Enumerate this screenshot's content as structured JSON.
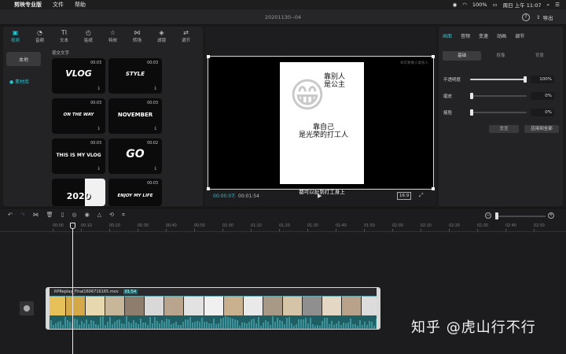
{
  "menubar": {
    "app_name": "剪映专业版",
    "items": [
      "文件",
      "帮助"
    ],
    "status": {
      "battery": "100%",
      "datetime": "周日 上午 11:07"
    }
  },
  "titlebar": {
    "title": "20201130--04",
    "export_label": "导出"
  },
  "media_panel": {
    "tabs": [
      {
        "label": "视频",
        "icon": "video-icon"
      },
      {
        "label": "音频",
        "icon": "audio-icon"
      },
      {
        "label": "文本",
        "icon": "text-icon"
      },
      {
        "label": "贴纸",
        "icon": "sticker-icon"
      },
      {
        "label": "特效",
        "icon": "effects-icon"
      },
      {
        "label": "转场",
        "icon": "transition-icon"
      },
      {
        "label": "滤镜",
        "icon": "filter-icon"
      },
      {
        "label": "调节",
        "icon": "adjust-icon"
      }
    ],
    "side": {
      "local": "本地",
      "library": "● 素材库"
    },
    "grid_title": "现交文字",
    "thumbs": [
      {
        "label": "VLOG",
        "duration": "00:03"
      },
      {
        "label": "STYLE",
        "duration": "00:03"
      },
      {
        "label": "ON THE WAY",
        "duration": "00:03"
      },
      {
        "label": "NOVEMBER",
        "duration": "00:03"
      },
      {
        "label": "THIS IS MY VLOG",
        "duration": "00:03"
      },
      {
        "label": "GO",
        "duration": "00:02"
      },
      {
        "label": "2020",
        "duration": "00:03"
      },
      {
        "label": "ENJOY MY LIFE",
        "duration": "00:03"
      }
    ]
  },
  "player": {
    "meme_top": "靠别人\n是公主",
    "meme_bottom": "靠自己\n是光荣的打工人",
    "meme_caption": "都可以扯到打工身上",
    "watermark": "本年要做人类技人",
    "current_time": "00:00:07",
    "total_time": "00:01:54",
    "ratio": "16:9"
  },
  "properties": {
    "tabs": [
      "画面",
      "音频",
      "变速",
      "动画",
      "调节"
    ],
    "subtabs": [
      "基础",
      "抠像",
      "背景"
    ],
    "rows": [
      {
        "label": "不透明度",
        "value": "100%",
        "level": 100
      },
      {
        "label": "磨皮",
        "value": "0%",
        "level": 0
      },
      {
        "label": "瘦脸",
        "value": "0%",
        "level": 0
      }
    ],
    "reset_label": "重置",
    "apply_label": "应用到全部"
  },
  "timeline": {
    "ticks": [
      "00:00",
      "00:10",
      "00:20",
      "00:30",
      "00:40",
      "00:50",
      "01:00",
      "01:10",
      "01:20",
      "01:30",
      "01:40",
      "01:50",
      "02:00",
      "02:10",
      "02:20",
      "02:30",
      "02:40",
      "02:50"
    ],
    "clip_name": "RPReplay_Final1606716165.mov",
    "clip_duration": "01:54"
  },
  "site_watermark": "知乎 @虎山行不行",
  "colors": {
    "accent": "#27c0cd",
    "clip": "#5fa3a8"
  }
}
